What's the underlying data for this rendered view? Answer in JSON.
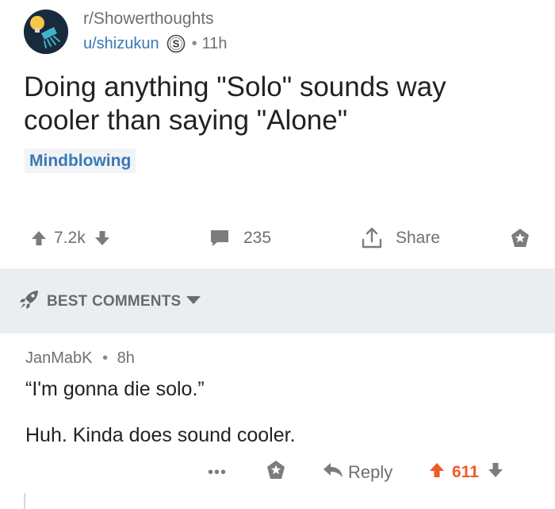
{
  "post": {
    "subreddit": "r/Showerthoughts",
    "username": "u/shizukun",
    "flair_letter": "S",
    "separator": "•",
    "time": "11h",
    "title_line1": "Doing anything \"Solo\" sounds way",
    "title_line2": "cooler than saying \"Alone\"",
    "tag": "Mindblowing"
  },
  "actions": {
    "upvotes": "7.2k",
    "comments": "235",
    "share": "Share"
  },
  "best_comments": {
    "label": "BEST COMMENTS"
  },
  "comment": {
    "author": "JanMabK",
    "separator": "•",
    "time": "8h",
    "line1": "“I'm gonna die solo.”",
    "line2": "Huh. Kinda does sound cooler.",
    "more": "•••",
    "reply": "Reply",
    "score": "611"
  },
  "colors": {
    "link_blue": "#3a78b8",
    "muted_gray": "#6f6f6f",
    "upvote_orange": "#f15a24",
    "section_bg": "#ebeef1"
  },
  "icons": {
    "avatar": "lightbulb-shower-icon",
    "flair": "s-badge-icon",
    "upvote": "arrow-up-icon",
    "downvote": "arrow-down-icon",
    "comments": "comment-bubble-icon",
    "share": "share-icon",
    "save": "star-icon",
    "best": "rocket-icon",
    "dropdown": "caret-down-icon",
    "reply": "reply-arrow-icon"
  }
}
